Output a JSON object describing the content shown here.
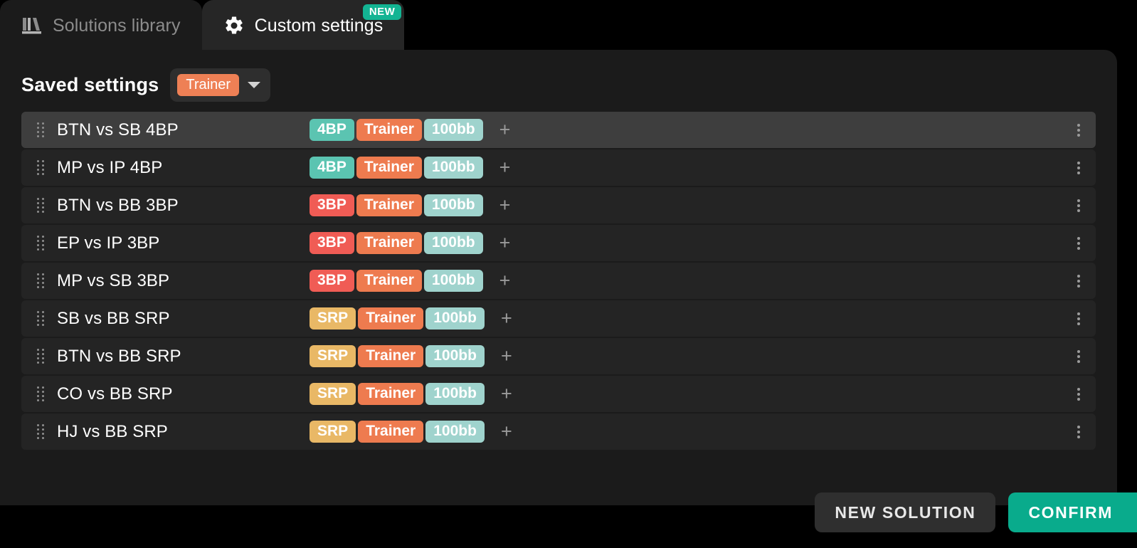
{
  "tabs": [
    {
      "label": "Solutions library",
      "icon": "library-icon",
      "active": false,
      "badge": null
    },
    {
      "label": "Custom settings",
      "icon": "gear-icon",
      "active": true,
      "badge": "NEW"
    }
  ],
  "panel": {
    "title": "Saved settings",
    "profile_select": {
      "value": "Trainer",
      "caret": "chevron-down-icon"
    },
    "add_tag_glyph": "+"
  },
  "rows": [
    {
      "label": "BTN vs SB 4BP",
      "tags": [
        "4BP",
        "Trainer",
        "100bb"
      ],
      "active": true
    },
    {
      "label": "MP vs IP 4BP",
      "tags": [
        "4BP",
        "Trainer",
        "100bb"
      ],
      "active": false
    },
    {
      "label": "BTN vs BB 3BP",
      "tags": [
        "3BP",
        "Trainer",
        "100bb"
      ],
      "active": false
    },
    {
      "label": "EP vs IP 3BP",
      "tags": [
        "3BP",
        "Trainer",
        "100bb"
      ],
      "active": false
    },
    {
      "label": "MP vs SB 3BP",
      "tags": [
        "3BP",
        "Trainer",
        "100bb"
      ],
      "active": false
    },
    {
      "label": "SB vs BB SRP",
      "tags": [
        "SRP",
        "Trainer",
        "100bb"
      ],
      "active": false
    },
    {
      "label": "BTN vs BB SRP",
      "tags": [
        "SRP",
        "Trainer",
        "100bb"
      ],
      "active": false
    },
    {
      "label": "CO vs BB SRP",
      "tags": [
        "SRP",
        "Trainer",
        "100bb"
      ],
      "active": false
    },
    {
      "label": "HJ vs BB SRP",
      "tags": [
        "SRP",
        "Trainer",
        "100bb"
      ],
      "active": false
    }
  ],
  "footer": {
    "new_solution_label": "NEW SOLUTION",
    "confirm_label": "CONFIRM"
  },
  "colors": {
    "page_background": "#000000",
    "panel_background": "#1b1b1b",
    "row_background": "#242424",
    "row_active_background": "#3e3e3e",
    "accent_teal": "#09ab8c",
    "badge_new": "#13b493",
    "tag_4BP": "#5bc4b1",
    "tag_3BP": "#f05c55",
    "tag_SRP": "#e9b866",
    "tag_Trainer": "#ee7b4f",
    "tag_100bb": "#9fd3cd"
  }
}
